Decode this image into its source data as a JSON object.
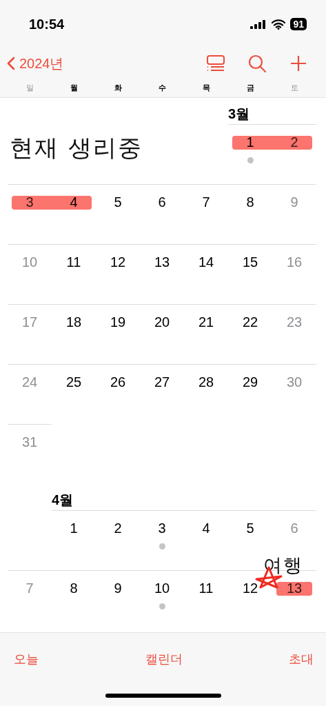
{
  "status_bar": {
    "time": "10:54",
    "battery": "91"
  },
  "nav": {
    "back_label": "2024년"
  },
  "weekdays": [
    {
      "label": "일",
      "weekend": true
    },
    {
      "label": "월",
      "weekend": false
    },
    {
      "label": "화",
      "weekend": false
    },
    {
      "label": "수",
      "weekend": false
    },
    {
      "label": "목",
      "weekend": false
    },
    {
      "label": "금",
      "weekend": false
    },
    {
      "label": "토",
      "weekend": true
    }
  ],
  "months": [
    {
      "label": "3월",
      "note": "현재 생리중",
      "weeks": [
        {
          "days": [
            {
              "kind": "blank"
            },
            {
              "kind": "blank"
            },
            {
              "kind": "blank"
            },
            {
              "kind": "blank"
            },
            {
              "kind": "blank"
            },
            {
              "kind": "day",
              "day": "1",
              "marked": true,
              "event": true
            },
            {
              "kind": "day",
              "day": "2",
              "marked": true,
              "event": false
            }
          ]
        },
        {
          "days": [
            {
              "kind": "day",
              "day": "3",
              "marked": true,
              "event": false
            },
            {
              "kind": "day",
              "day": "4",
              "marked": true,
              "event": false
            },
            {
              "kind": "day",
              "day": "5",
              "marked": false,
              "event": false
            },
            {
              "kind": "day",
              "day": "6",
              "marked": false,
              "event": false
            },
            {
              "kind": "day",
              "day": "7",
              "marked": false,
              "event": false
            },
            {
              "kind": "day",
              "day": "8",
              "marked": false,
              "event": false
            },
            {
              "kind": "day",
              "day": "9",
              "marked": false,
              "event": false
            }
          ]
        },
        {
          "days": [
            {
              "kind": "day",
              "day": "10",
              "marked": false,
              "event": false
            },
            {
              "kind": "day",
              "day": "11",
              "marked": false,
              "event": false
            },
            {
              "kind": "day",
              "day": "12",
              "marked": false,
              "event": false
            },
            {
              "kind": "day",
              "day": "13",
              "marked": false,
              "event": false
            },
            {
              "kind": "day",
              "day": "14",
              "marked": false,
              "event": false
            },
            {
              "kind": "day",
              "day": "15",
              "marked": false,
              "event": false
            },
            {
              "kind": "day",
              "day": "16",
              "marked": false,
              "event": false
            }
          ]
        },
        {
          "days": [
            {
              "kind": "day",
              "day": "17",
              "marked": false,
              "event": false
            },
            {
              "kind": "day",
              "day": "18",
              "marked": false,
              "event": false
            },
            {
              "kind": "day",
              "day": "19",
              "marked": false,
              "event": false
            },
            {
              "kind": "day",
              "day": "20",
              "marked": false,
              "event": false
            },
            {
              "kind": "day",
              "day": "21",
              "marked": false,
              "event": false
            },
            {
              "kind": "day",
              "day": "22",
              "marked": false,
              "event": false
            },
            {
              "kind": "day",
              "day": "23",
              "marked": false,
              "event": false
            }
          ]
        },
        {
          "days": [
            {
              "kind": "day",
              "day": "24",
              "marked": false,
              "event": false
            },
            {
              "kind": "day",
              "day": "25",
              "marked": false,
              "event": false
            },
            {
              "kind": "day",
              "day": "26",
              "marked": false,
              "event": false
            },
            {
              "kind": "day",
              "day": "27",
              "marked": false,
              "event": false
            },
            {
              "kind": "day",
              "day": "28",
              "marked": false,
              "event": false
            },
            {
              "kind": "day",
              "day": "29",
              "marked": false,
              "event": false
            },
            {
              "kind": "day",
              "day": "30",
              "marked": false,
              "event": false
            }
          ]
        },
        {
          "days": [
            {
              "kind": "day",
              "day": "31",
              "marked": false,
              "event": false
            },
            {
              "kind": "blank"
            },
            {
              "kind": "blank"
            },
            {
              "kind": "blank"
            },
            {
              "kind": "blank"
            },
            {
              "kind": "blank"
            },
            {
              "kind": "blank"
            }
          ]
        }
      ]
    },
    {
      "label": "4월",
      "note": "여행",
      "weeks": [
        {
          "days": [
            {
              "kind": "blank"
            },
            {
              "kind": "day",
              "day": "1",
              "marked": false,
              "event": false
            },
            {
              "kind": "day",
              "day": "2",
              "marked": false,
              "event": false
            },
            {
              "kind": "day",
              "day": "3",
              "marked": false,
              "event": true
            },
            {
              "kind": "day",
              "day": "4",
              "marked": false,
              "event": false
            },
            {
              "kind": "day",
              "day": "5",
              "marked": false,
              "event": false
            },
            {
              "kind": "day",
              "day": "6",
              "marked": false,
              "event": false
            }
          ]
        },
        {
          "days": [
            {
              "kind": "day",
              "day": "7",
              "marked": false,
              "event": false
            },
            {
              "kind": "day",
              "day": "8",
              "marked": false,
              "event": false
            },
            {
              "kind": "day",
              "day": "9",
              "marked": false,
              "event": false
            },
            {
              "kind": "day",
              "day": "10",
              "marked": false,
              "event": true
            },
            {
              "kind": "day",
              "day": "11",
              "marked": false,
              "event": false
            },
            {
              "kind": "day",
              "day": "12",
              "marked": false,
              "event": false
            },
            {
              "kind": "day",
              "day": "13",
              "marked": true,
              "event": false
            }
          ]
        }
      ]
    }
  ],
  "toolbar": {
    "today": "오늘",
    "calendars": "캘린더",
    "inbox": "초대"
  }
}
